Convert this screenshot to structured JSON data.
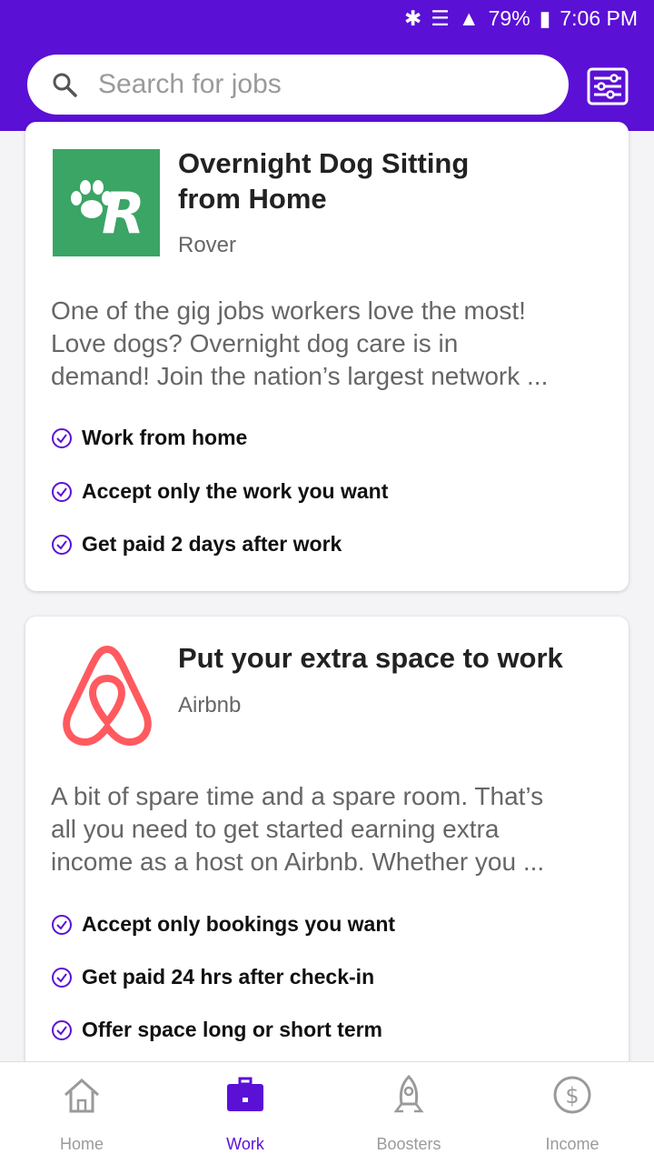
{
  "status_bar": {
    "bluetooth_icon": "bluetooth-icon",
    "wifi_icon": "wifi-icon",
    "signal_icon": "signal-icon",
    "battery_text": "79%",
    "time": "7:06 PM"
  },
  "header": {
    "search_placeholder": "Search for jobs",
    "search_icon": "search-icon",
    "filter_icon": "filter-icon"
  },
  "jobs": [
    {
      "title_line1": "Overnight Dog Sitting",
      "title_line2": "from Home",
      "company": "Rover",
      "desc_line1": "One of the gig jobs workers love the most!",
      "desc_line2": "Love dogs? Overnight dog care is in",
      "desc_line3": "demand! Join the nation’s largest network ...",
      "perks": [
        "Work from home",
        "Accept only the work you want",
        "Get paid 2 days after work"
      ]
    },
    {
      "title": "Put your extra space to work",
      "company": "Airbnb",
      "desc_line1": "A bit of spare time and a spare room. That’s",
      "desc_line2": "all you need to get started earning extra",
      "desc_line3": "income as a host on Airbnb. Whether you ...",
      "perks": [
        "Accept only bookings you want",
        "Get paid 24 hrs after check-in",
        "Offer space long or short term"
      ]
    }
  ],
  "nav": {
    "home": "Home",
    "work": "Work",
    "boosters": "Boosters",
    "income": "Income"
  },
  "colors": {
    "accent": "#5b10d6",
    "rover_green": "#3aa565",
    "airbnb_red": "#ff5a5f"
  }
}
